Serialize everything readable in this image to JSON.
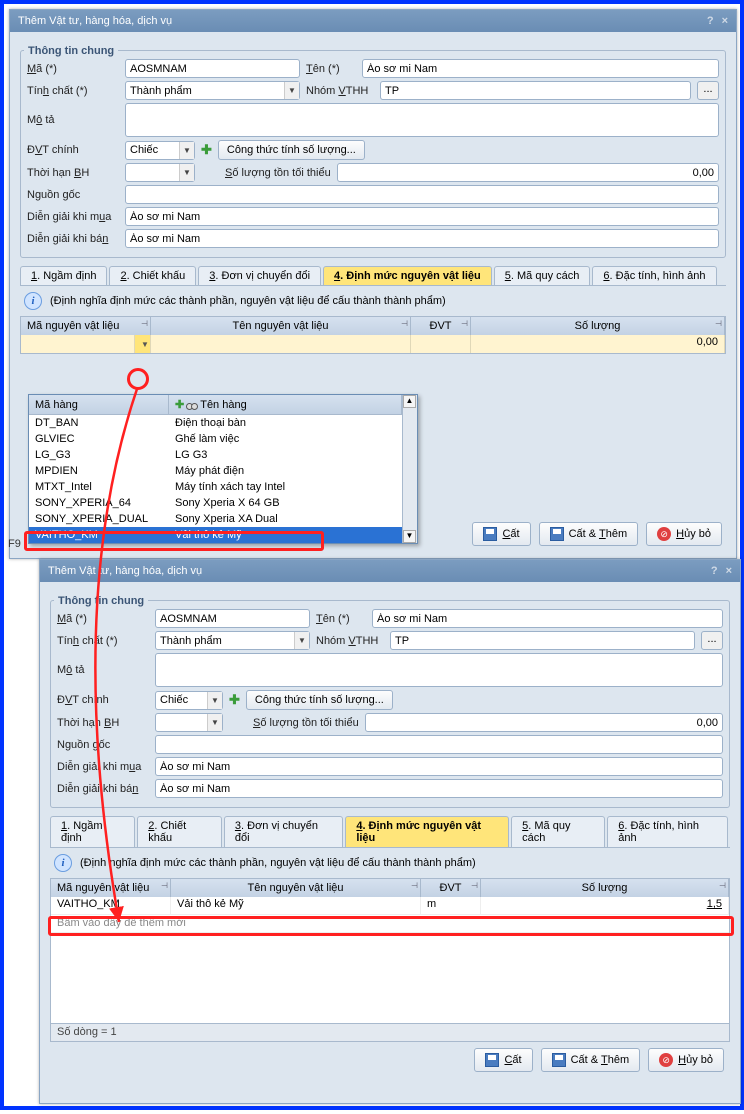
{
  "dialog": {
    "title": "Thêm Vật tư, hàng hóa, dịch vụ",
    "help": "?",
    "close": "×"
  },
  "general": {
    "legend": "Thông tin chung",
    "labels": {
      "code": "Mã (*)",
      "name": "Tên (*)",
      "nature": "Tính chất (*)",
      "group": "Nhóm VTHH",
      "desc": "Mô tả",
      "unit": "ĐVT chính",
      "formula_btn": "Công thức tính số lượng...",
      "warranty": "Thời hạn BH",
      "min_stock": "Số lượng tồn tối thiểu",
      "origin": "Nguồn gốc",
      "note_buy": "Diễn giải khi mua",
      "note_sell": "Diễn giải khi bán"
    },
    "values": {
      "code": "AOSMNAM",
      "name": "Áo sơ mi Nam",
      "nature": "Thành phẩm",
      "group": "TP",
      "desc": "",
      "unit": "Chiếc",
      "warranty": "",
      "min_stock": "0,00",
      "origin": "",
      "note_buy": "Áo sơ mi Nam",
      "note_sell": "Áo sơ mi Nam"
    }
  },
  "tabs": [
    {
      "label": "1. Ngầm định",
      "u": "1"
    },
    {
      "label": "2. Chiết khấu",
      "u": "2"
    },
    {
      "label": "3. Đơn vị chuyển đổi",
      "u": "3"
    },
    {
      "label": "4. Định mức nguyên vật liệu",
      "u": "4",
      "active": true
    },
    {
      "label": "5. Mã quy cách",
      "u": "5"
    },
    {
      "label": "6. Đặc tính, hình ảnh",
      "u": "6"
    }
  ],
  "info_text": "(Định nghĩa định mức các thành phần, nguyên vật liệu để cấu thành thành phẩm)",
  "grid": {
    "headers": [
      "Mã nguyên vật liệu",
      "Tên nguyên vật liệu",
      "ĐVT",
      "Số lượng"
    ],
    "empty_qty": "0,00",
    "hint": "Bấm vào đây để thêm mới",
    "footer": "Số dòng = 1"
  },
  "dropdown": {
    "col_code": "Mã hàng",
    "col_name": "Tên hàng",
    "rows": [
      {
        "code": "DT_BAN",
        "name": "Điện thoại bàn"
      },
      {
        "code": "GLVIEC",
        "name": "Ghế làm việc"
      },
      {
        "code": "LG_G3",
        "name": "LG G3"
      },
      {
        "code": "MPDIEN",
        "name": "Máy phát điện"
      },
      {
        "code": "MTXT_Intel",
        "name": "Máy tính xách tay Intel"
      },
      {
        "code": "SONY_XPERIA_64",
        "name": "Sony Xperia X 64 GB"
      },
      {
        "code": "SONY_XPERIA_DUAL",
        "name": "Sony Xperia XA Dual"
      },
      {
        "code": "VAITHO_KM",
        "name": "Vải thô kẻ Mỹ",
        "selected": true
      }
    ]
  },
  "f9_label": "F9",
  "result_row": {
    "code": "VAITHO_KM",
    "name": "Vải thô kẻ Mỹ",
    "uom": "m",
    "qty": "1,5"
  },
  "buttons": {
    "save": "Cất",
    "save_add": "Cất & Thêm",
    "cancel": "Hủy bỏ"
  }
}
